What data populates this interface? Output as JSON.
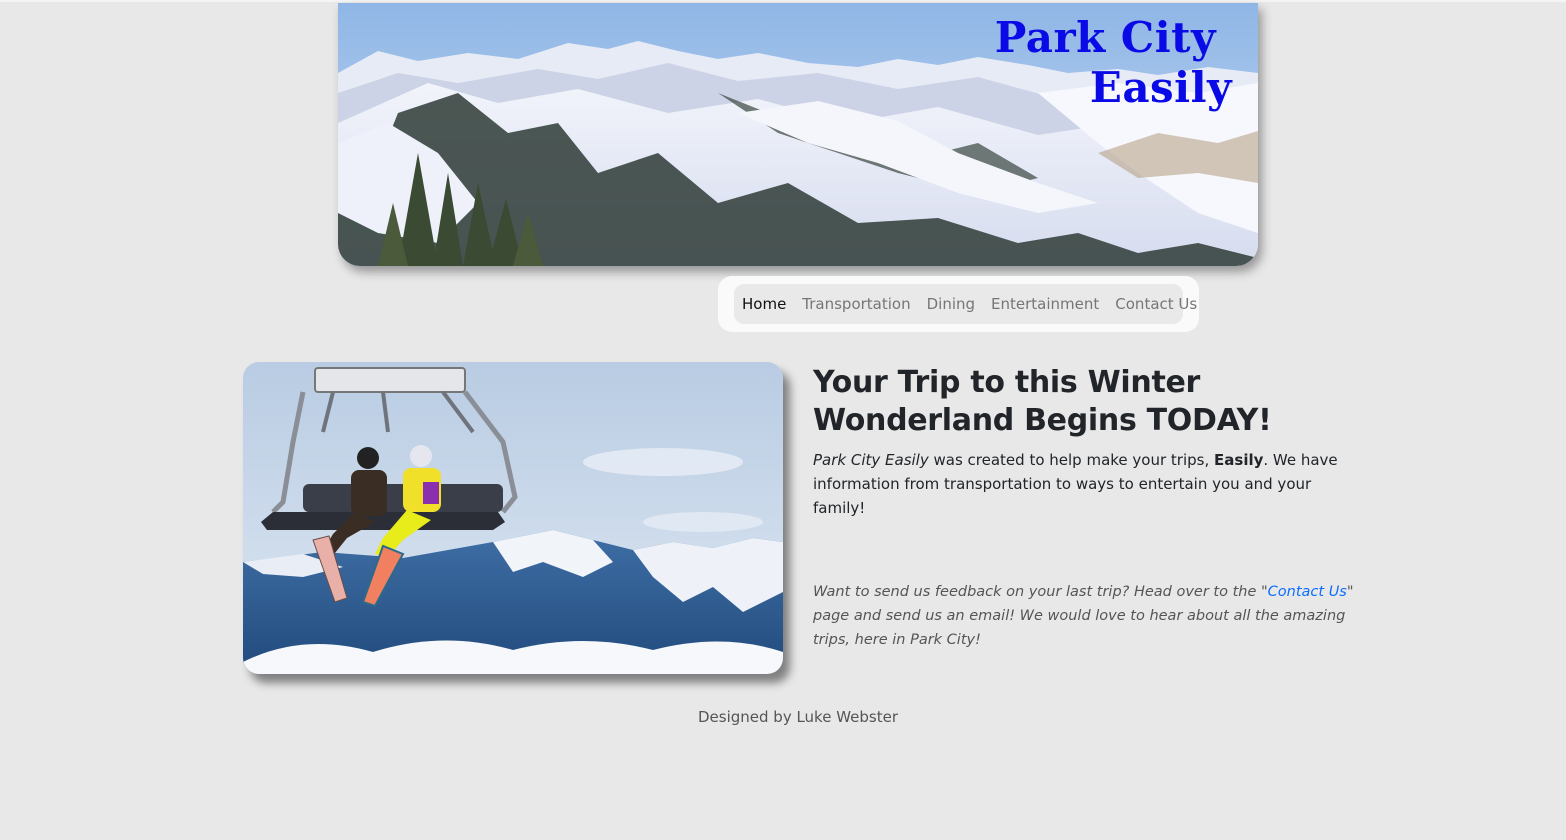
{
  "brand": {
    "line1": "Park City",
    "line2": "Easily"
  },
  "nav": {
    "items": [
      {
        "label": "Home",
        "active": true
      },
      {
        "label": "Transportation",
        "active": false
      },
      {
        "label": "Dining",
        "active": false
      },
      {
        "label": "Entertainment",
        "active": false
      },
      {
        "label": "Contact Us",
        "active": false
      }
    ]
  },
  "main": {
    "heading": "Your Trip to this Winter Wonderland Begins TODAY!",
    "intro": {
      "brand_italic": "Park City Easily",
      "text1": " was created to help make your trips, ",
      "bold": "Easily",
      "text2": ". We have information from transportation to ways to entertain you and your family!"
    },
    "feedback": {
      "before": "Want to send us feedback on your last trip? Head over to the \"",
      "link": "Contact Us",
      "after": "\" page and send us an email! We would love to hear about all the amazing trips, here in Park City!"
    }
  },
  "footer": {
    "text": "Designed by Luke Webster"
  },
  "colors": {
    "brand": "#0a0ae6",
    "link": "#0d6efd",
    "background": "#e8e8e8"
  }
}
